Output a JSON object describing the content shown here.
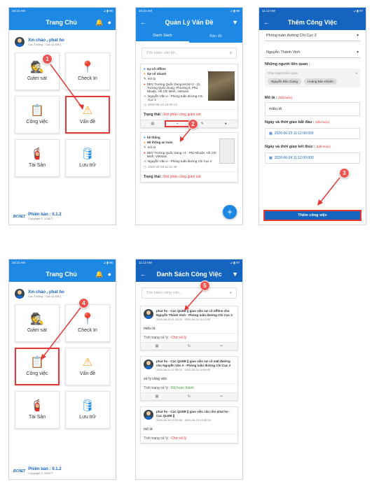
{
  "colors": {
    "primary": "#1e88e5",
    "dark": "#1565c0",
    "highlight": "#e53935",
    "marker": "#ef5350"
  },
  "screen1": {
    "status": {
      "time": "10:22 AM",
      "right": "⊿ ▮ 96"
    },
    "title": "Trang Chủ",
    "greeting": "Xin chào , phat ho",
    "role": "Cục Trưởng - Cục QLĐB ||",
    "tiles": [
      {
        "label": "Giám sát",
        "icon": "supervisor-icon"
      },
      {
        "label": "Check In",
        "icon": "location-pin-icon"
      },
      {
        "label": "Công việc",
        "icon": "task-list-icon"
      },
      {
        "label": "Vấn đề",
        "icon": "warning-icon"
      },
      {
        "label": "Tài Sản",
        "icon": "asset-icon"
      },
      {
        "label": "Lưu trữ",
        "icon": "database-icon"
      }
    ],
    "version": "Phiên bản : 0.1.2",
    "copyright": "Copyright © JCNET",
    "logo": "BCNET",
    "marker": "1"
  },
  "screen2": {
    "status": {
      "time": "10:22 AM",
      "right": "⊿ ▮ 96"
    },
    "title": "Quản Lý Vấn Đề",
    "tabs": [
      "Danh Sách",
      "Bản đồ"
    ],
    "search_placeholder": "Tìm kiếm vấn đề..",
    "card1": {
      "l1": "sự cố offline",
      "l2": "Sự cố nhanh",
      "l3": "mô tả",
      "l4": "DEV Trường Quốc Dung km34+2 - 21 Trường Quốc Dung, Phường 8, Phú Nhuận, Hồ Chí Minh, Vietnam",
      "l5": "Nguyễn Văn A - Phòng tuần đường Chi Cục 2",
      "l6": "2020-06-22 14:40:13",
      "status_label": "Trạng thái :",
      "status_value": "Đợi phân công giám sát"
    },
    "card2": {
      "l1": "hệ thống",
      "l2": "Hệ thống an toàn",
      "l3": "mô tả",
      "l4": "DEV Trường Quốc Dung +4 - Phú Nhuận, Hồ Chí Minh, Vietnam",
      "l5": "Nguyễn Văn A - Phòng tuần đường Chi Cục 2",
      "l6": "2020-06-19 11:41:39",
      "status_label": "Trạng thái :",
      "status_value": "Đợi phân công giám sát"
    },
    "marker": "2"
  },
  "screen3": {
    "status": {
      "time": "11:12 AM",
      "right": "⊿ ▮ 97"
    },
    "title": "Thêm Công Việc",
    "select1": "Phòng tuần đường Chi Cục 2",
    "select2": "Nguyễn Thành Vinh",
    "related_label": "Những người liên quan :",
    "related_placeholder": "Chọn người liên quan",
    "chips": [
      "Nguyễn Bảo Giang",
      "Hoàng Bảo Khánh"
    ],
    "desc_label": "Mô tả :",
    "required": "(bắt buộc)",
    "desc_value": "miêu tả",
    "start_label": "Ngày và thời gian bắt đầu :",
    "start_value": "2020-06-23 11:12:00.000",
    "end_label": "Ngày và thời gian kết thúc :",
    "end_value": "2020-06-24 11:12:00.000",
    "submit": "Thêm công việc",
    "marker": "3"
  },
  "screen4": {
    "status": {
      "time": "10:22 AM",
      "right": "⊿ ▮ 96"
    },
    "title": "Trang Chủ",
    "greeting": "Xin chào , phat ho",
    "role": "Cục Trưởng - Cục QLĐB ||",
    "tiles": [
      {
        "label": "Giám sát"
      },
      {
        "label": "Check In"
      },
      {
        "label": "Công việc"
      },
      {
        "label": "Vấn đề"
      },
      {
        "label": "Tài Sản"
      },
      {
        "label": "Lưu trữ"
      }
    ],
    "version": "Phiên bản : 0.1.2",
    "copyright": "Copyright © JCNET",
    "logo": "BCNET",
    "marker": "4"
  },
  "screen5": {
    "status": {
      "time": "11:12 AM",
      "right": "⊿ ▮ 97"
    },
    "title": "Danh Sách Công Việc",
    "search_placeholder": "Tìm kiếm công việc..",
    "tasks": [
      {
        "head": "phat ho - Cục QLĐB || giao việc sự cố offline cho Nguyễn Thành Vinh - Phòng tuần đường Chi Cục 2",
        "time": "2020-06-23 11:12:00 - 2020-06-24 11:12:00",
        "desc": "miêu tả",
        "status_label": "Tình trạng xử lý :",
        "status": "Chờ xử lý"
      },
      {
        "head": "phat ho - Cục QLĐB || giao việc sự cố mặt đường cho Nguyễn Văn A - Phòng tuần đường Chi Cục 2",
        "time": "2020-06-22 11:59:00 - 2020-06-24 11:59:00",
        "desc": "xử lý công việc",
        "status_label": "Tình trạng xử lý :",
        "status": "Đã hoàn thành"
      },
      {
        "head": "phat ho - Cục QLĐB || giao việc cầu cho phat ho - Cục QLĐB ||",
        "time": "2020-06-19 12:00:00 - 2020-06-23 13:00:00",
        "desc": "mô tả",
        "status_label": "Tình trạng xử lý :",
        "status": "Chờ xử lý"
      }
    ],
    "marker": "5"
  }
}
